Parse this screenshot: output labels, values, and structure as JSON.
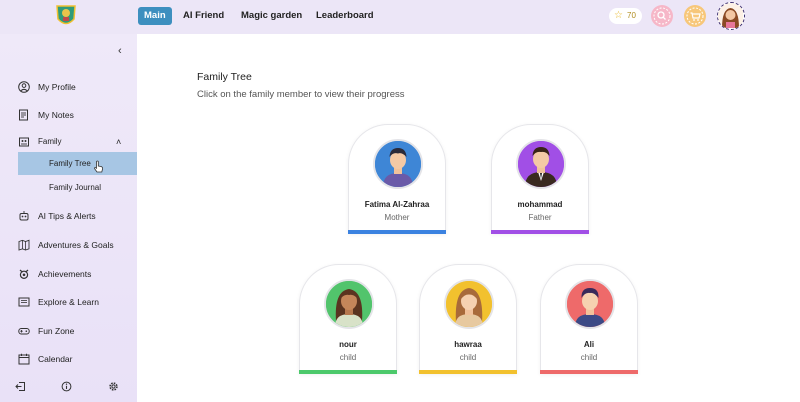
{
  "nav": {
    "tabs": [
      "Main",
      "AI Friend",
      "Magic garden",
      "Leaderboard"
    ],
    "coins": "70"
  },
  "sidebar": {
    "items": [
      {
        "label": "My Profile",
        "icon": "user-circle-icon"
      },
      {
        "label": "My Notes",
        "icon": "notes-icon"
      },
      {
        "label": "Family",
        "icon": "family-icon"
      },
      {
        "label": "AI Tips & Alerts",
        "icon": "robot-icon"
      },
      {
        "label": "Adventures & Goals",
        "icon": "map-icon"
      },
      {
        "label": "Achievements",
        "icon": "medal-icon"
      },
      {
        "label": "Explore & Learn",
        "icon": "book-icon"
      },
      {
        "label": "Fun Zone",
        "icon": "gamepad-icon"
      },
      {
        "label": "Calendar",
        "icon": "calendar-icon"
      }
    ],
    "family_sub": [
      "Family Tree",
      "Family Journal"
    ]
  },
  "main": {
    "title": "Family Tree",
    "subtitle": "Click on the family member to view their progress",
    "members": [
      {
        "name": "Fatima Al-Zahraa",
        "role": "Mother",
        "color": "#3b82e0"
      },
      {
        "name": "mohammad",
        "role": "Father",
        "color": "#a14fe6"
      },
      {
        "name": "nour",
        "role": "child",
        "color": "#4cc96b"
      },
      {
        "name": "hawraa",
        "role": "child",
        "color": "#f2c12e"
      },
      {
        "name": "Ali",
        "role": "child",
        "color": "#ee6a6a"
      }
    ]
  },
  "colors": {
    "accent": "#3d8fbf",
    "sidebar_bg": "#ece6f7",
    "active_sub": "#a7c6e4"
  }
}
